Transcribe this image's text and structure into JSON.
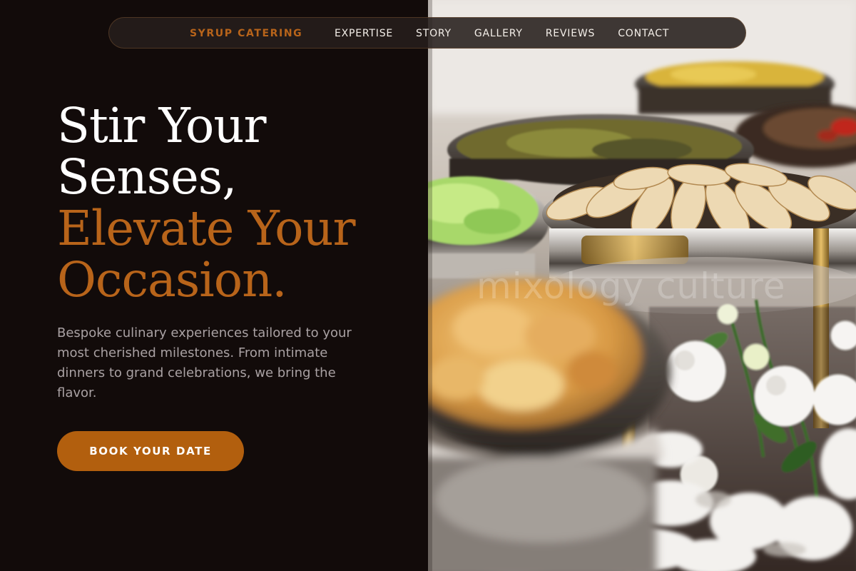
{
  "nav": {
    "brand": "SYRUP CATERING",
    "links": [
      "EXPERTISE",
      "STORY",
      "GALLERY",
      "REVIEWS",
      "CONTACT"
    ]
  },
  "hero": {
    "headline_line1": "Stir Your",
    "headline_line2": "Senses,",
    "headline_line3": "Elevate Your",
    "headline_line4": "Occasion.",
    "description": "Bespoke culinary experiences tailored to your most cherished milestones. From intimate dinners to grand celebrations, we bring the flavor.",
    "cta_label": "BOOK YOUR DATE",
    "image_watermark": "mixology culture"
  },
  "colors": {
    "background": "#120b0a",
    "accent": "#b8641a",
    "button": "#b25f0e",
    "heading": "#ffffff",
    "body_text": "#a9a1a3"
  },
  "icons": {
    "hero_image": "catering-buffet-photo"
  }
}
